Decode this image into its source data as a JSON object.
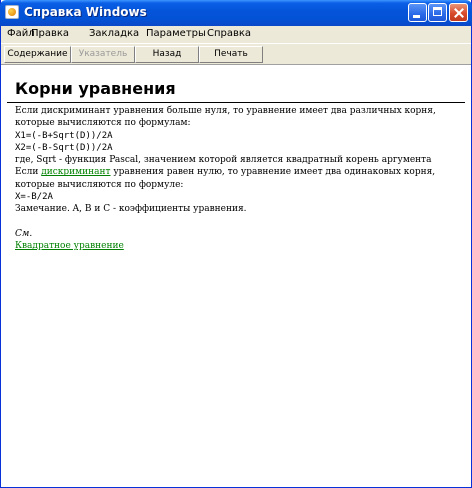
{
  "window": {
    "title": "Справка Windows"
  },
  "menu": {
    "items": [
      "Файл",
      "Правка",
      "Закладка",
      "Параметры",
      "Справка"
    ]
  },
  "toolbar": {
    "contents": "Содержание",
    "index": "Указатель",
    "back": "Назад",
    "print": "Печать"
  },
  "topic": {
    "title": "Корни уравнения",
    "line1": "Если дискриминант уравнения больше нуля, то уравнение имеет два различных корня,",
    "line2": "которые вычисляются по формулам:",
    "x1_formula": "X1=(-B+Sqrt(D))/2A",
    "x2_formula": "X2=(-B-Sqrt(D))/2A",
    "line5": "где, Sqrt - функция Pascal, значением которой является квадратный корень аргумента",
    "line6_pre": "Если ",
    "line6_link": "дискриминант",
    "line6_post": " уравнения равен нулю, то уравнение имеет два одинаковых корня,",
    "line7": "которые вычисляются по формуле:",
    "x_formula": "X=-B/2A",
    "note": "Замечание. A, B и C - коэффициенты уравнения.",
    "see_also": "См.",
    "related_link": "Квадратное уравнение"
  },
  "colors": {
    "link": "#008000",
    "titlebar": "#0453d8",
    "chrome": "#ece9d8"
  }
}
